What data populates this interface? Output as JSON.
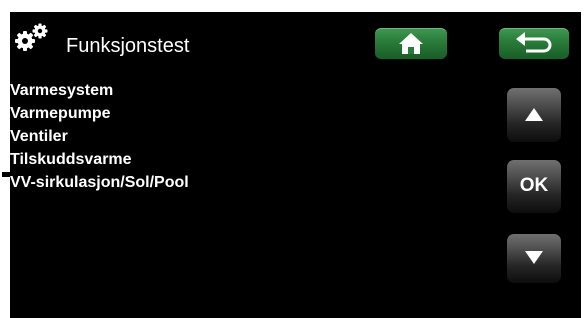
{
  "header": {
    "icon": "gears-icon",
    "title": "Funksjonstest",
    "home_icon": "home-icon",
    "back_icon": "back-arrow-icon"
  },
  "menu": {
    "items": [
      {
        "label": "Varmesystem"
      },
      {
        "label": "Varmepumpe"
      },
      {
        "label": "Ventiler"
      },
      {
        "label": "Tilskuddsvarme"
      },
      {
        "label": "VV-sirkulasjon/Sol/Pool"
      }
    ]
  },
  "nav": {
    "up_icon": "arrow-up-icon",
    "ok_label": "OK",
    "down_icon": "arrow-down-icon"
  },
  "colors": {
    "background": "#000000",
    "text": "#ffffff",
    "green_button": "#2c7d3c",
    "gray_button": "#4f4f4f"
  }
}
